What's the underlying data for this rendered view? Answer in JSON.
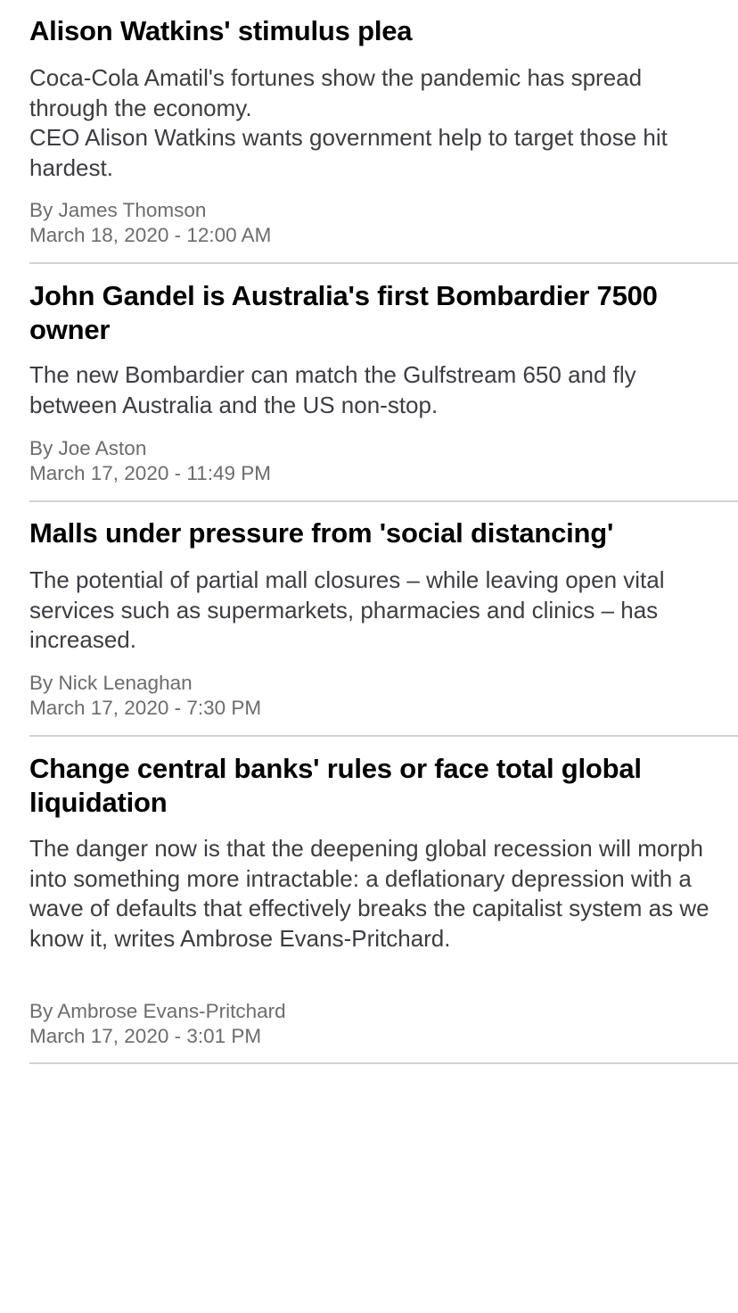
{
  "articles": [
    {
      "headline": "Alison Watkins' stimulus plea",
      "summary": "Coca-Cola Amatil's fortunes show the pandemic has spread through the economy.\nCEO Alison Watkins wants government help to target those hit hardest.",
      "byline": "By James Thomson",
      "date": "March 18, 2020 - 12:00 AM"
    },
    {
      "headline": "John Gandel is Australia's first Bombardier 7500 owner",
      "summary": "The new Bombardier can match the Gulfstream 650 and fly between Australia and the US non-stop.",
      "byline": "By Joe Aston",
      "date": "March 17, 2020 - 11:49 PM"
    },
    {
      "headline": "Malls under pressure from 'social distancing'",
      "summary": "The potential of partial mall closures – while leaving open vital services such as supermarkets, pharmacies and clinics – has increased.",
      "byline": "By Nick Lenaghan",
      "date": "March 17, 2020 - 7:30 PM"
    },
    {
      "headline": "Change central banks' rules or face total global liquidation",
      "summary": "The danger now is that the deepening global recession will morph into something more intractable: a deflationary depression with a wave of defaults that effectively breaks the capitalist system as we know it, writes Ambrose Evans-Pritchard.",
      "byline": "By Ambrose Evans-Pritchard",
      "date": "March 17, 2020 - 3:01 PM"
    }
  ]
}
